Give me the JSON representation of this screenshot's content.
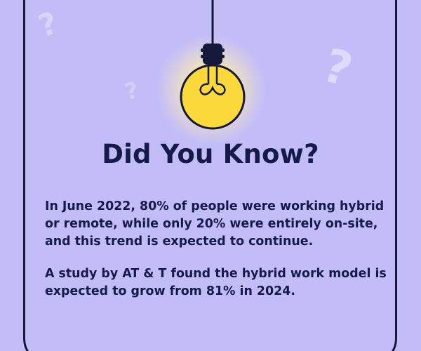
{
  "card": {
    "title": "Did You Know?",
    "paragraphs": [
      "In June 2022, 80% of people were working hybrid or remote, while only 20% were entirely on-site, and this trend is expected to continue.",
      "A study by AT & T found the hybrid work model is expected to grow from 81% in 2024."
    ]
  },
  "colors": {
    "background": "#c3bdf7",
    "text": "#151a4b",
    "frame": "#14193a",
    "bulb": "#fbd93a",
    "glow": "#fff4b0",
    "question_marks": "#dedbfb"
  },
  "icons": {
    "bulb": "lightbulb-icon",
    "decor": "question-mark-icon"
  }
}
